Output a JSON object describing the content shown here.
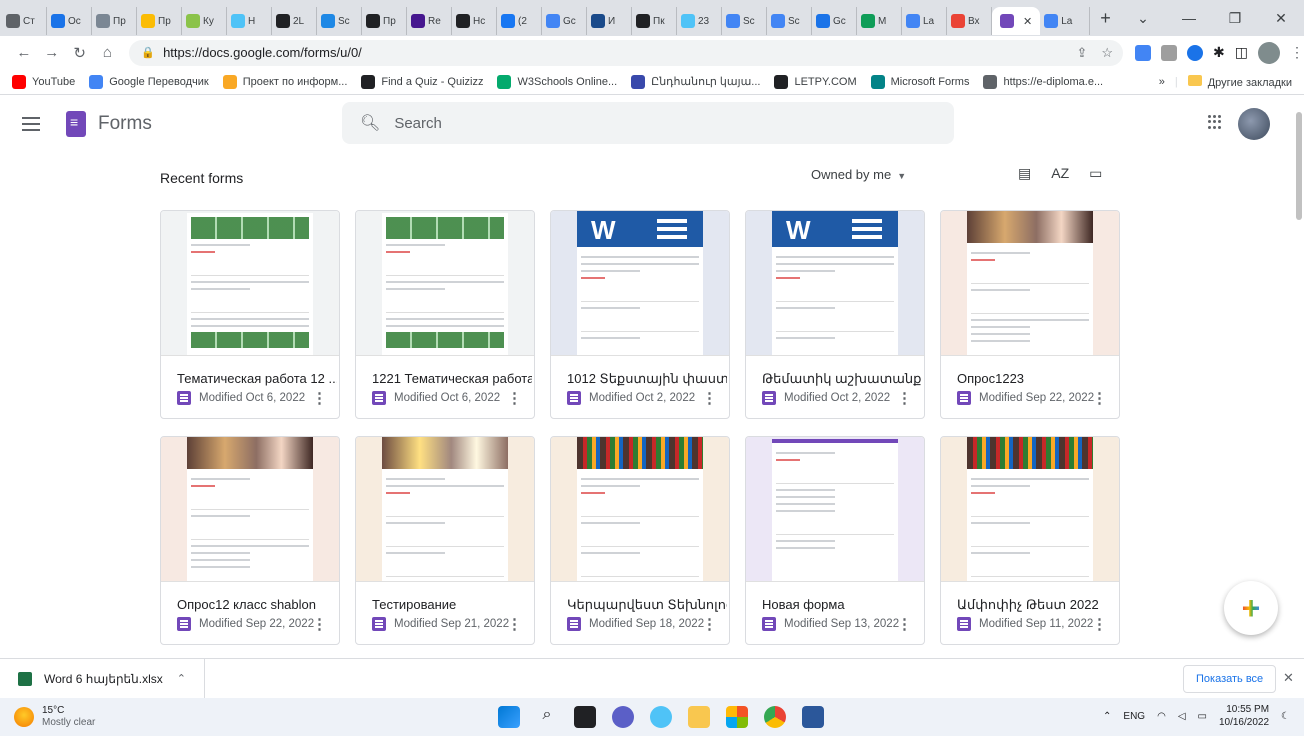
{
  "browser": {
    "tabs": [
      {
        "label": "Ст",
        "color": "#5f6368"
      },
      {
        "label": "Ос",
        "color": "#1a73e8"
      },
      {
        "label": "Пр",
        "color": "#7b8794"
      },
      {
        "label": "Пр",
        "color": "#fbbc04"
      },
      {
        "label": "Ку",
        "color": "#8bc34a"
      },
      {
        "label": "Н",
        "color": "#4fc3f7"
      },
      {
        "label": "2L",
        "color": "#202124"
      },
      {
        "label": "Sc",
        "color": "#1e88e5"
      },
      {
        "label": "Пр",
        "color": "#202124"
      },
      {
        "label": "Re",
        "color": "#46178f"
      },
      {
        "label": "Нс",
        "color": "#202124"
      },
      {
        "label": "(2",
        "color": "#1877f2"
      },
      {
        "label": "Gc",
        "color": "#4285f4"
      },
      {
        "label": "И",
        "color": "#1a4a8a"
      },
      {
        "label": "Пк",
        "color": "#202124"
      },
      {
        "label": "23",
        "color": "#4fc3f7"
      },
      {
        "label": "Sc",
        "color": "#4285f4"
      },
      {
        "label": "Sc",
        "color": "#4285f4"
      },
      {
        "label": "Gc",
        "color": "#1a73e8"
      },
      {
        "label": "М",
        "color": "#0f9d58"
      },
      {
        "label": "La",
        "color": "#4285f4"
      },
      {
        "label": "Вх",
        "color": "#ea4335"
      }
    ],
    "active_tab": {
      "label": "",
      "close": "✕"
    },
    "last_tab": {
      "label": "La",
      "color": "#4285f4"
    },
    "new_tab": "+",
    "url": "https://docs.google.com/forms/u/0/",
    "bookmarks": [
      {
        "label": "YouTube",
        "color": "#ff0000"
      },
      {
        "label": "Google Переводчик",
        "color": "#4285f4"
      },
      {
        "label": "Проект по информ...",
        "color": "#f9a825"
      },
      {
        "label": "Find a Quiz - Quizizz",
        "color": "#202124"
      },
      {
        "label": "W3Schools Online...",
        "color": "#04aa6d"
      },
      {
        "label": "Ընդհանուր կայա...",
        "color": "#3949ab"
      },
      {
        "label": "LETPY.COM",
        "color": "#202124"
      },
      {
        "label": "Microsoft Forms",
        "color": "#038387"
      },
      {
        "label": "https://e-diploma.e...",
        "color": "#5f6368"
      }
    ],
    "other_bookmarks": "Другие закладки",
    "more": "»"
  },
  "app": {
    "title": "Forms",
    "search_placeholder": "Search"
  },
  "toolbar": {
    "section_title": "Recent forms",
    "owner_filter": "Owned by me",
    "caret": "▼",
    "sort_icon": "AZ"
  },
  "forms": [
    {
      "title": "Тематическая работа 12 ...",
      "modified": "Modified Oct 6, 2022",
      "thumb": "sheet",
      "bg": "#f1f3f4"
    },
    {
      "title": "1221 Тематическая работа",
      "modified": "Modified Oct 6, 2022",
      "thumb": "sheet",
      "bg": "#f1f3f4"
    },
    {
      "title": "1012 Տեքստային փաստ...",
      "modified": "Modified Oct 2, 2022",
      "thumb": "word",
      "bg": "#e3e7f1"
    },
    {
      "title": "Թեմատիկ աշխատանք ...",
      "modified": "Modified Oct 2, 2022",
      "thumb": "word",
      "bg": "#e3e7f1"
    },
    {
      "title": "Опрос1223",
      "modified": "Modified Sep 22, 2022",
      "thumb": "grad",
      "bg": "#f7e9e2"
    },
    {
      "title": "Опрос12 класс shablon",
      "modified": "Modified Sep 22, 2022",
      "thumb": "grad",
      "bg": "#f7e9e2"
    },
    {
      "title": "Тестирование",
      "modified": "Modified Sep 21, 2022",
      "thumb": "coffee",
      "bg": "#f7ecdf"
    },
    {
      "title": "Կերպարվեստ Տեխնոլոգ...",
      "modified": "Modified Sep 18, 2022",
      "thumb": "books",
      "bg": "#f7ecdf"
    },
    {
      "title": "Новая форма",
      "modified": "Modified Sep 13, 2022",
      "thumb": "plain",
      "bg": "#ece7f6"
    },
    {
      "title": "Ամփոփիչ Թեստ 2022",
      "modified": "Modified Sep 11, 2022",
      "thumb": "books",
      "bg": "#f7ecdf"
    }
  ],
  "downloads": {
    "file": "Word 6 հայերեն.xlsx",
    "show_all": "Показать все"
  },
  "taskbar": {
    "temp": "15°C",
    "weather": "Mostly clear",
    "lang": "ENG",
    "time": "10:55 PM",
    "date": "10/16/2022"
  }
}
